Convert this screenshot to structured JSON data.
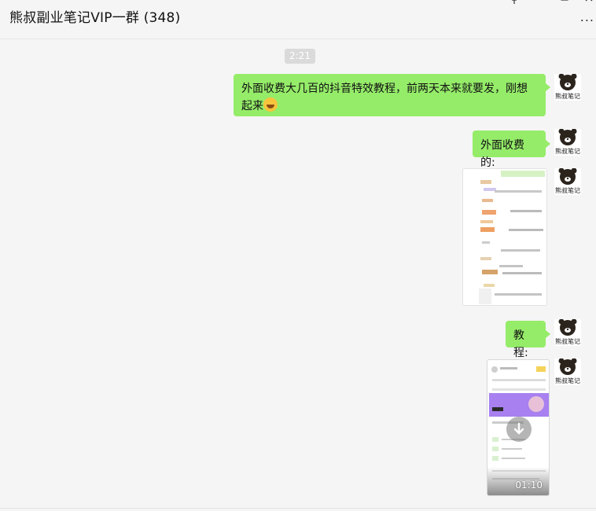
{
  "header": {
    "title": "熊叔副业笔记VIP一群 (348)",
    "pin_icon": "pin-icon",
    "minimize_icon": "minimize-icon",
    "maximize_icon": "maximize-icon",
    "close_icon": "close-icon",
    "more_label": "..."
  },
  "chat": {
    "timestamp": "2:21",
    "avatar_text": "熊叔笔记",
    "messages": [
      {
        "type": "text",
        "text": "外面收费大几百的抖音特效教程，前两天本来就要发，刚想起来",
        "emoji": "grinning-squint-emoji"
      },
      {
        "type": "text",
        "text": "外面收费的:"
      },
      {
        "type": "image",
        "icon": "screenshot-image"
      },
      {
        "type": "text",
        "text": "教程:"
      },
      {
        "type": "video",
        "duration": "01:10",
        "icon": "download-icon"
      }
    ]
  },
  "colors": {
    "bubble": "#95ec69",
    "background": "#f5f5f5",
    "timestamp_bg": "#dadada"
  }
}
